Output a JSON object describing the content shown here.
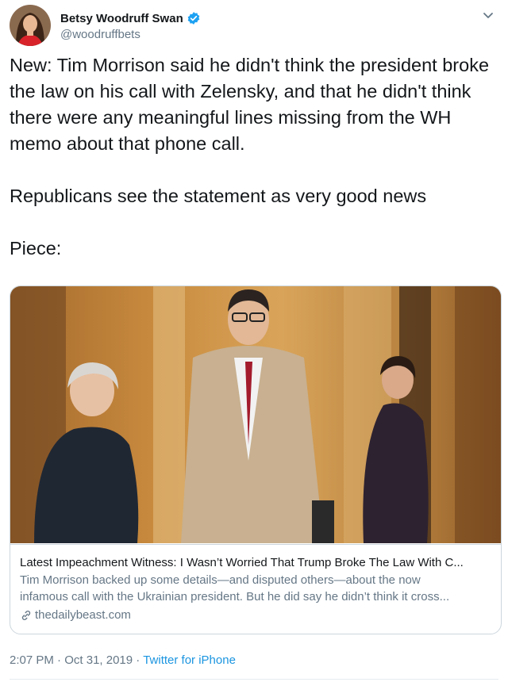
{
  "author": {
    "display_name": "Betsy Woodruff Swan",
    "handle": "@woodruffbets",
    "verified": true
  },
  "tweet": {
    "paragraph1": "New: Tim Morrison said he didn't think the president broke the law on his call with Zelensky, and that he didn't think there were any meaningful lines missing from the WH memo about that phone call.",
    "paragraph2": "Republicans see the statement as very good news",
    "paragraph3": "Piece:"
  },
  "card": {
    "title": "Latest Impeachment Witness: I Wasn’t Worried That Trump Broke The Law With C...",
    "description_line1": "Tim Morrison backed up some details—and disputed others—about the now",
    "description_line2": "infamous call with the Ukrainian president. But he did say he didn’t think it cross...",
    "domain": "thedailybeast.com"
  },
  "meta": {
    "time": "2:07 PM",
    "separator1": " · ",
    "date": "Oct 31, 2019",
    "separator2": " · ",
    "source": "Twitter for iPhone"
  },
  "colors": {
    "accent": "#1da1f2",
    "link": "#1b95e0",
    "secondary_text": "#657786",
    "border": "#ccd6dd"
  },
  "icons": {
    "verified": "verified-badge-icon",
    "caret": "chevron-down-icon",
    "link": "link-icon"
  }
}
